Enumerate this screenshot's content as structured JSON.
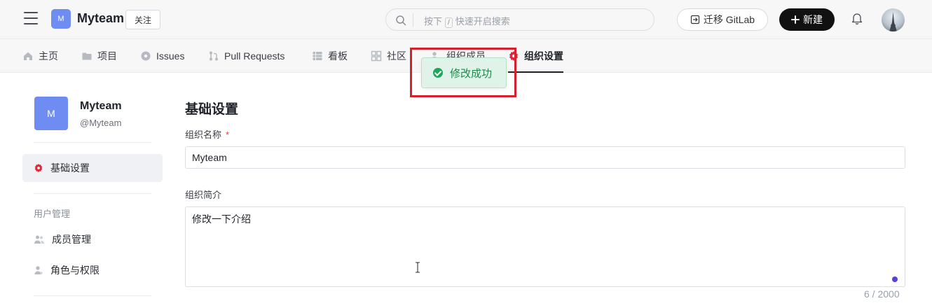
{
  "header": {
    "team_logo_letter": "M",
    "team_name": "Myteam",
    "follow_label": "关注",
    "search": {
      "prefix": "按下",
      "key": "/",
      "suffix": "快速开启搜索"
    },
    "gitlab_label": "迁移 GitLab",
    "new_label": "新建"
  },
  "nav": {
    "tabs": [
      {
        "label": "主页"
      },
      {
        "label": "项目"
      },
      {
        "label": "Issues"
      },
      {
        "label": "Pull Requests"
      },
      {
        "label": "看板"
      },
      {
        "label": "社区"
      },
      {
        "label": "组织成员"
      },
      {
        "label": "组织设置",
        "active": true
      }
    ]
  },
  "toast": {
    "message": "修改成功",
    "type": "success"
  },
  "sidebar": {
    "logo_letter": "M",
    "name": "Myteam",
    "handle": "@Myteam",
    "items": [
      {
        "label": "基础设置",
        "active": true
      },
      {
        "label": "成员管理"
      },
      {
        "label": "角色与权限"
      }
    ],
    "group_label": "用户管理"
  },
  "form": {
    "title": "基础设置",
    "name_label": "组织名称",
    "required_mark": "*",
    "name_value": "Myteam",
    "intro_label": "组织简介",
    "intro_value": "修改一下介绍",
    "counter": "6 / 2000"
  },
  "colors": {
    "accent": "#6f8cf2",
    "success": "#1fa65a",
    "highlight": "#d7202c",
    "settings_icon": "#e0243a"
  }
}
